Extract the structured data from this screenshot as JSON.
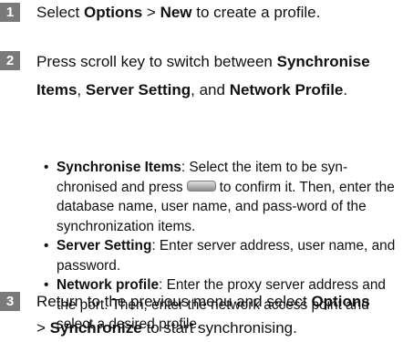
{
  "steps": [
    {
      "number": "1",
      "text_a": "Select ",
      "b1": "Options",
      "text_b": " > ",
      "b2": "New",
      "text_c": " to create a profile."
    },
    {
      "number": "2",
      "text_a": "Press scroll key to switch between ",
      "b1": "Synchronise Items",
      "text_b": ", ",
      "b2": "Server Setting",
      "text_c": ", and ",
      "b3": "Network Profile",
      "text_d": "."
    },
    {
      "number": "3",
      "text_a": "Return to the previous menu and select ",
      "b1": "Options",
      "text_b": " > ",
      "b2": "Synchronize",
      "text_c": " to start synchronising."
    }
  ],
  "bullets": [
    {
      "marker": "•",
      "bold": "Synchronise Items",
      "text_a": ": Select the item to be syn-chronised and press",
      "key_icon": "confirm-key-icon",
      "text_b": "to confirm it. Then, enter the database name, user name, and pass-word of the synchronization items."
    },
    {
      "marker": "•",
      "bold": "Server Setting",
      "text_a": ": Enter server address, user name, and password."
    },
    {
      "marker": "•",
      "bold": "Network profile",
      "text_a": ": Enter the proxy server address and the port. Then, enter the network access point and select a desired profile."
    }
  ],
  "colors": {
    "badge": "#7a7a7a",
    "text": "#111111"
  }
}
